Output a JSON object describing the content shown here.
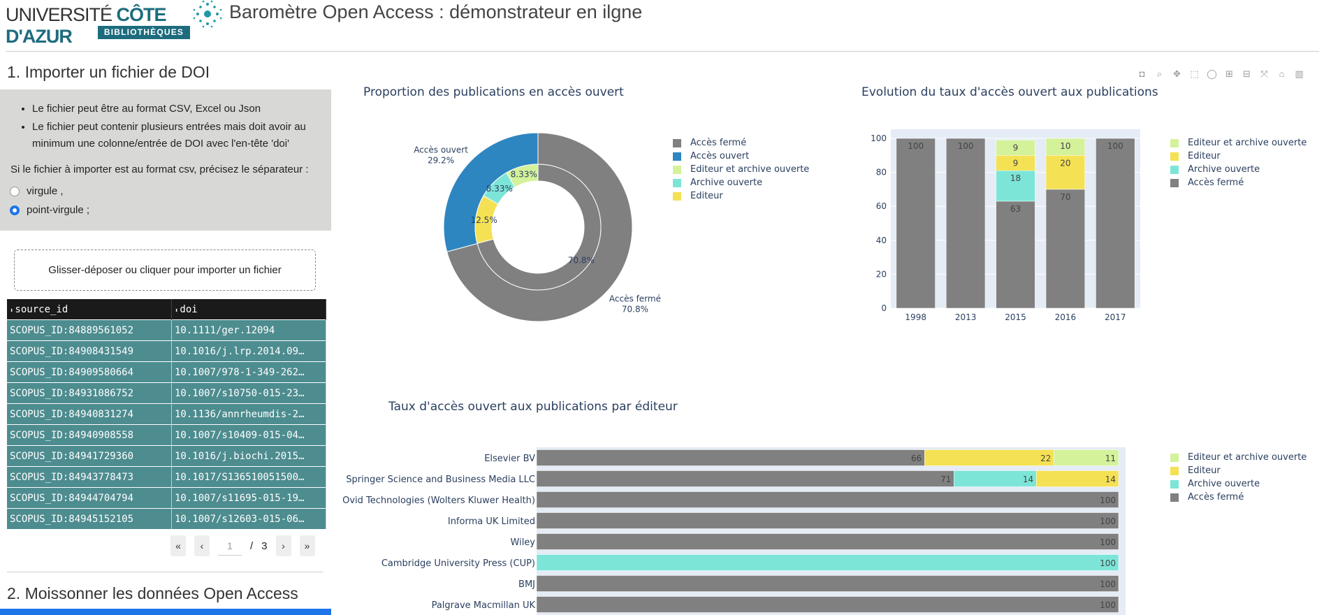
{
  "header": {
    "logo_univ": "UNIVERSITÉ",
    "logo_cote": "CÔTE D'AZUR",
    "logo_biblio": "BIBLIOTHÈQUES",
    "title": "Baromètre Open Access : démonstrateur en ilgne"
  },
  "section1": {
    "title": "1. Importer un fichier de DOI",
    "bullets": [
      "Le fichier peut être au format CSV, Excel ou Json",
      "Le fichier peut contenir plusieurs entrées mais doit avoir au minimum une colonne/entrée de DOI avec l'en-tête 'doi'"
    ],
    "separator_label": "Si le fichier à importer est au format csv, précisez le séparateur :",
    "radio_options": [
      "virgule ,",
      "point-virgule ;"
    ],
    "selected": "point-virgule ;",
    "upload_label": "Glisser-déposer ou cliquer pour importer un fichier"
  },
  "table": {
    "columns": [
      "source_id",
      "doi"
    ],
    "rows": [
      [
        "SCOPUS_ID:84889561052",
        "10.1111/ger.12094"
      ],
      [
        "SCOPUS_ID:84908431549",
        "10.1016/j.lrp.2014.09…"
      ],
      [
        "SCOPUS_ID:84909580664",
        "10.1007/978-1-349-262…"
      ],
      [
        "SCOPUS_ID:84931086752",
        "10.1007/s10750-015-23…"
      ],
      [
        "SCOPUS_ID:84940831274",
        "10.1136/annrheumdis-2…"
      ],
      [
        "SCOPUS_ID:84940908558",
        "10.1007/s10409-015-04…"
      ],
      [
        "SCOPUS_ID:84941729360",
        "10.1016/j.biochi.2015…"
      ],
      [
        "SCOPUS_ID:84943778473",
        "10.1017/S136510051500…"
      ],
      [
        "SCOPUS_ID:84944704794",
        "10.1007/s11695-015-19…"
      ],
      [
        "SCOPUS_ID:84945152105",
        "10.1007/s12603-015-06…"
      ]
    ],
    "page_current": "1",
    "page_sep": "/",
    "page_total": "3",
    "btn_first": "«",
    "btn_prev": "‹",
    "btn_next": "›",
    "btn_last": "»"
  },
  "section2": {
    "title": "2. Moissonner les données Open Access"
  },
  "modebar_icons": [
    "camera-icon",
    "zoom-icon",
    "pan-icon",
    "box-select-icon",
    "lasso-icon",
    "zoom-in-icon",
    "zoom-out-icon",
    "autoscale-icon",
    "reset-axes-icon",
    "plotly-logo-icon"
  ],
  "colors": {
    "ferme": "#808080",
    "ouvert": "#2e86c1",
    "editeur_archive": "#d4f29a",
    "archive": "#7de5d8",
    "editeur": "#f4e154",
    "plot_bg": "#e5ecf6"
  },
  "chart_data": [
    {
      "type": "pie",
      "title": "Proportion des publications en accès ouvert",
      "outer": [
        {
          "label": "Accès fermé",
          "value": 70.8,
          "text": "Accès fermé\n70.8%"
        },
        {
          "label": "Accès ouvert",
          "value": 29.2,
          "text": "Accès ouvert\n29.2%"
        }
      ],
      "inner": [
        {
          "label": "Accès fermé",
          "value": 70.8,
          "text": "70.8%"
        },
        {
          "label": "Editeur",
          "value": 12.5,
          "text": "12.5%"
        },
        {
          "label": "Archive ouverte",
          "value": 8.33,
          "text": "8.33%"
        },
        {
          "label": "Editeur et archive ouverte",
          "value": 8.33,
          "text": "8.33%"
        }
      ],
      "legend": [
        "Accès fermé",
        "Accès ouvert",
        "Editeur et archive ouverte",
        "Archive ouverte",
        "Editeur"
      ]
    },
    {
      "type": "bar",
      "stacked": true,
      "title": "Evolution du taux d'accès ouvert aux publications",
      "categories": [
        "1998",
        "2013",
        "2015",
        "2016",
        "2017"
      ],
      "ylim": [
        0,
        100
      ],
      "yticks": [
        "0",
        "20",
        "40",
        "60",
        "80",
        "100"
      ],
      "series": [
        {
          "name": "Accès fermé",
          "values": [
            100,
            100,
            63,
            70,
            100
          ]
        },
        {
          "name": "Archive ouverte",
          "values": [
            0,
            0,
            18,
            0,
            0
          ]
        },
        {
          "name": "Editeur",
          "values": [
            0,
            0,
            9,
            20,
            0
          ]
        },
        {
          "name": "Editeur et archive ouverte",
          "values": [
            0,
            0,
            9,
            10,
            0
          ]
        }
      ],
      "legend": [
        "Editeur et archive ouverte",
        "Editeur",
        "Archive ouverte",
        "Accès fermé"
      ]
    },
    {
      "type": "bar",
      "orientation": "horizontal",
      "stacked": true,
      "title": "Taux d'accès ouvert aux publications par éditeur",
      "categories": [
        "Elsevier BV",
        "Springer Science and Business Media LLC",
        "Ovid Technologies (Wolters Kluwer Health)",
        "Informa UK Limited",
        "Wiley",
        "Cambridge University Press (CUP)",
        "BMJ",
        "Palgrave Macmillan UK"
      ],
      "series": [
        {
          "name": "Accès fermé",
          "values": [
            66,
            71,
            100,
            100,
            100,
            0,
            100,
            100
          ]
        },
        {
          "name": "Archive ouverte",
          "values": [
            0,
            14,
            0,
            0,
            0,
            100,
            0,
            0
          ]
        },
        {
          "name": "Editeur",
          "values": [
            22,
            14,
            0,
            0,
            0,
            0,
            0,
            0
          ]
        },
        {
          "name": "Editeur et archive ouverte",
          "values": [
            11,
            0,
            0,
            0,
            0,
            0,
            0,
            0
          ]
        }
      ],
      "legend": [
        "Editeur et archive ouverte",
        "Editeur",
        "Archive ouverte",
        "Accès fermé"
      ]
    }
  ]
}
